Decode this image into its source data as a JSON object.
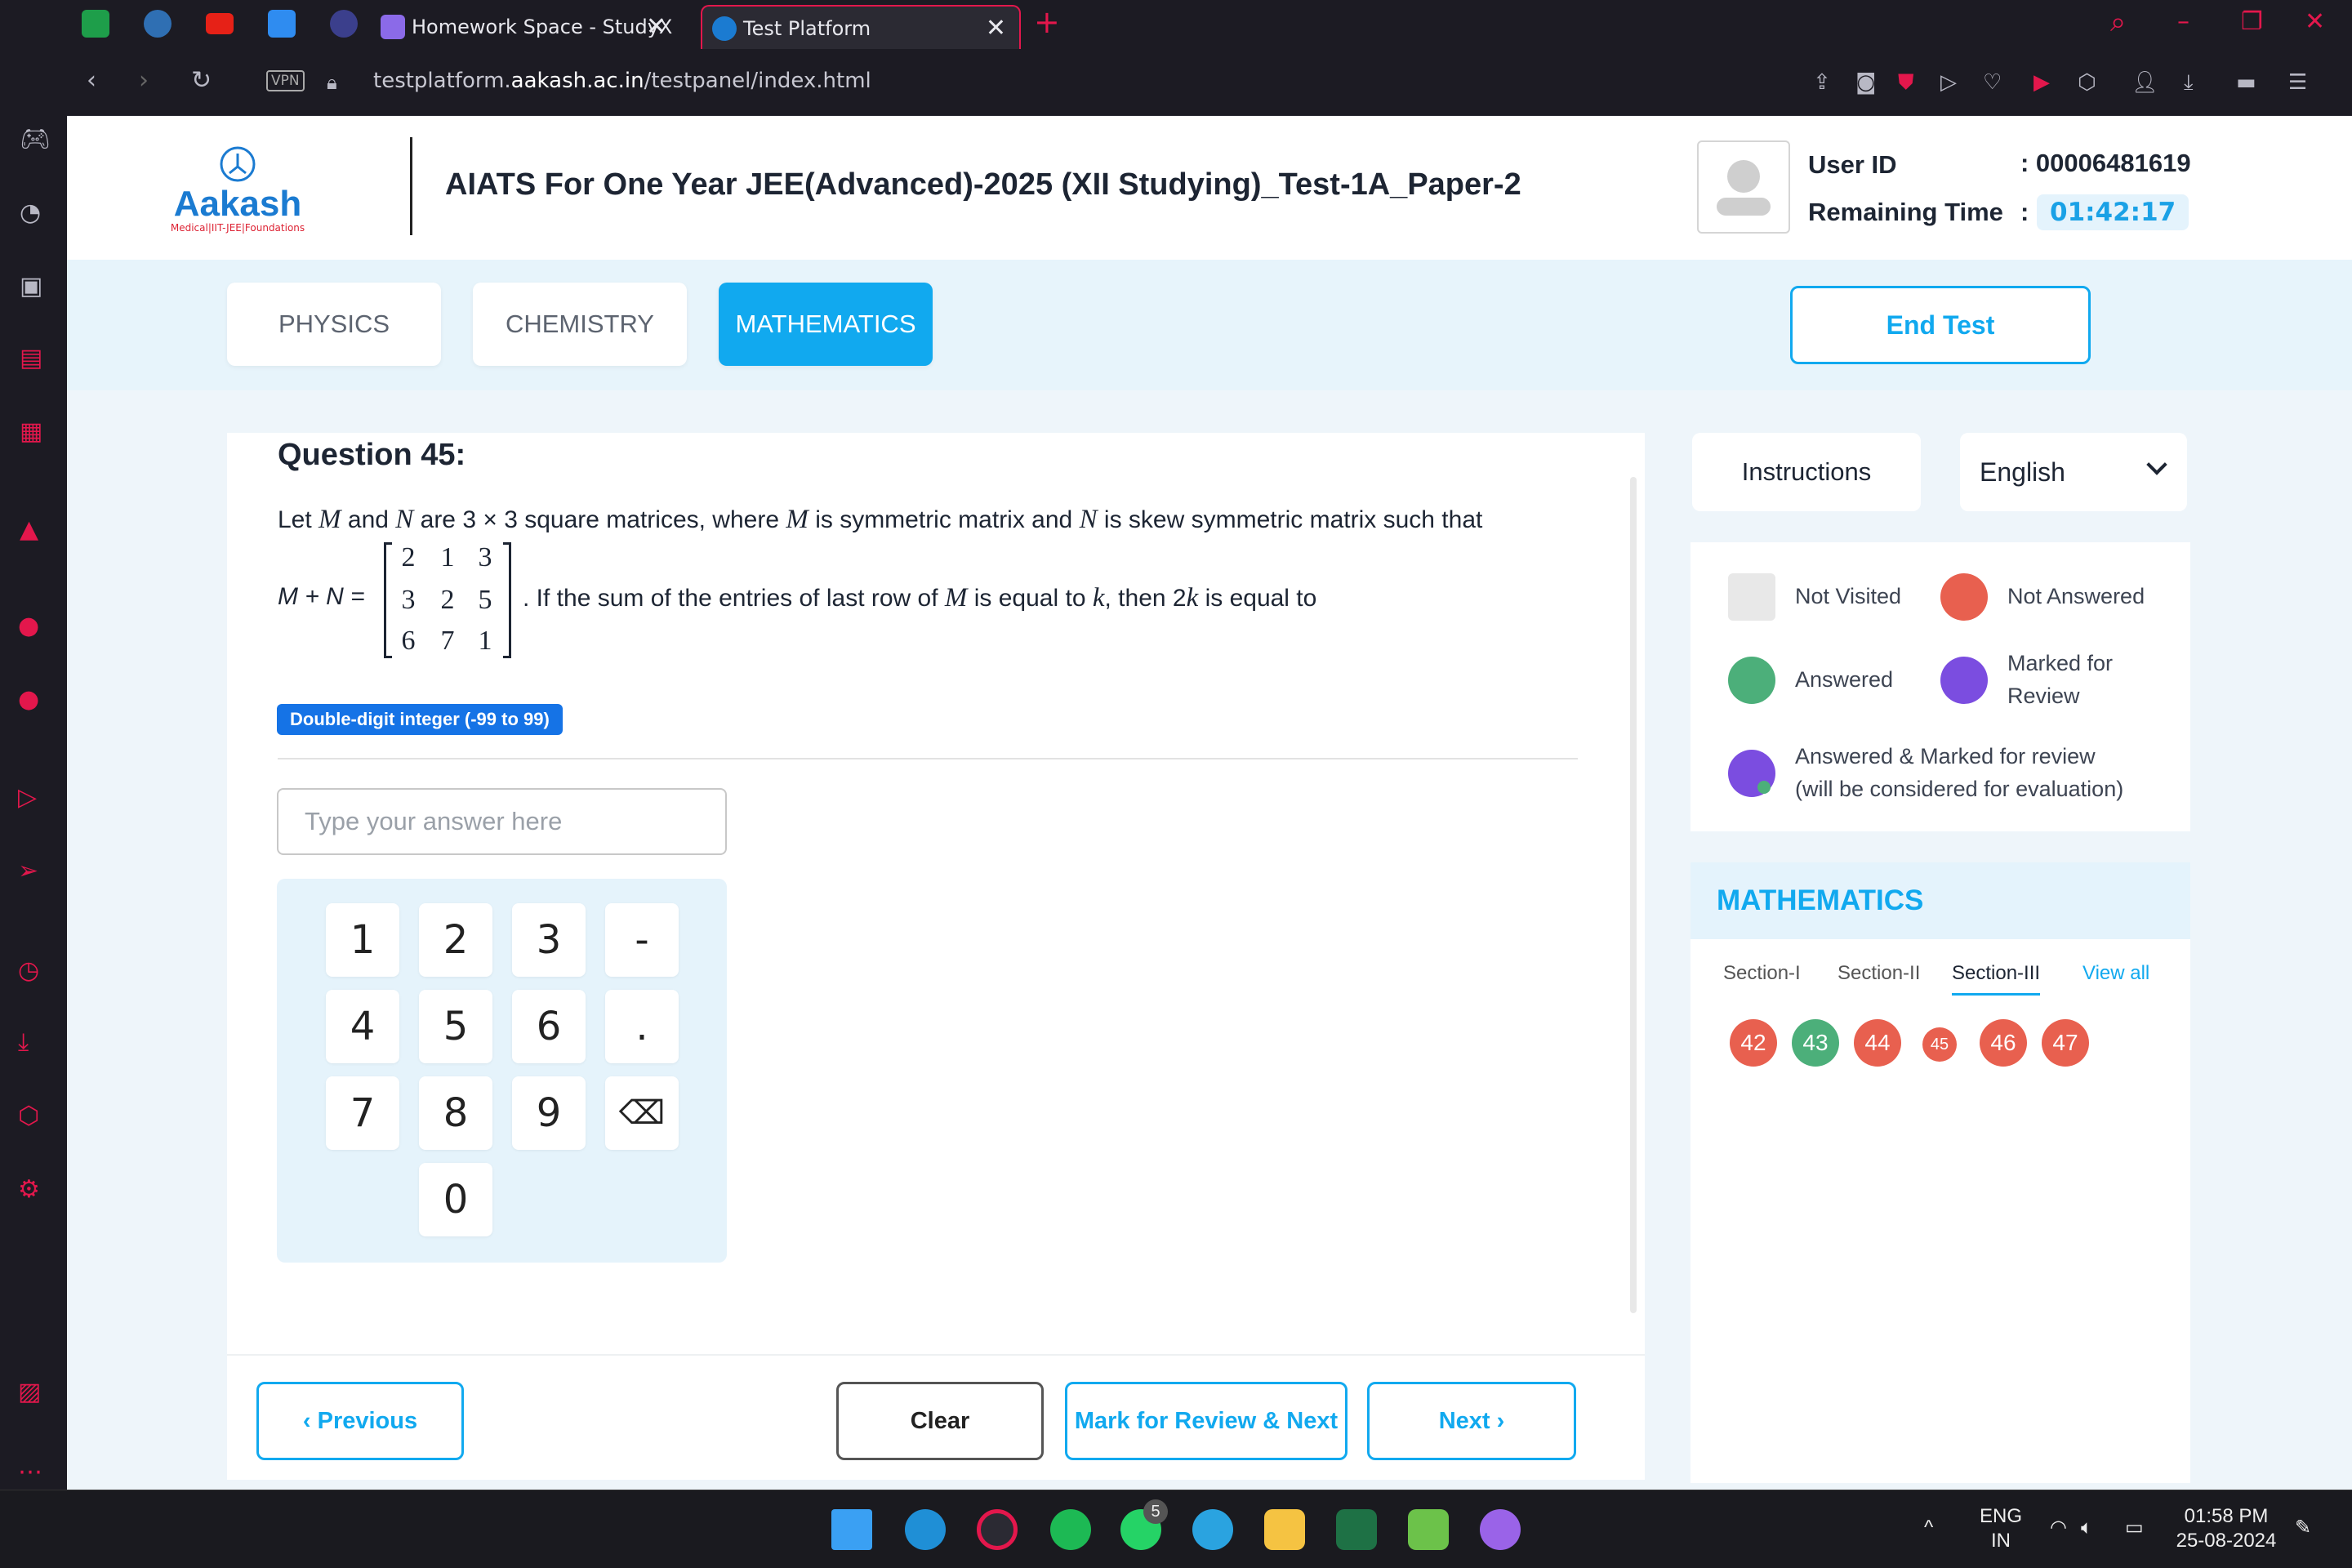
{
  "browser": {
    "tabs": [
      {
        "title": "Homework Space - StudyX",
        "close": "✕"
      },
      {
        "title": "Test Platform",
        "close": "✕"
      }
    ],
    "new_tab": "+",
    "url_prefix": "testplatform.",
    "url_domain": "aakash.ac.in",
    "url_path": "/testpanel/index.html",
    "vpn": "VPN"
  },
  "header": {
    "logo_name": "Aakash",
    "logo_sub": "Medical|IIT-JEE|Foundations",
    "test_title": "AIATS For One Year JEE(Advanced)-2025 (XII Studying)_Test-1A_Paper-2",
    "user_id_label": "User ID",
    "user_id_value": ": 00006481619",
    "remaining_label": "Remaining Time",
    "remaining_colon": ":",
    "remaining_value": "01:42:17"
  },
  "subjects": [
    {
      "label": "PHYSICS",
      "active": false
    },
    {
      "label": "CHEMISTRY",
      "active": false
    },
    {
      "label": "MATHEMATICS",
      "active": true
    }
  ],
  "end_test": "End Test",
  "question": {
    "title": "Question 45:",
    "line1_a": "Let ",
    "var_M": "M",
    "line1_b": " and ",
    "var_N": "N",
    "line1_c": " are 3 × 3 square matrices, where ",
    "line1_d": " is symmetric matrix and ",
    "line1_e": " is skew symmetric matrix such that",
    "lhs": "M + N =",
    "matrix": [
      [
        "2",
        "1",
        "3"
      ],
      [
        "3",
        "2",
        "5"
      ],
      [
        "6",
        "7",
        "1"
      ]
    ],
    "line2_a": ". If the sum of the entries of last row of ",
    "line2_b": " is equal to ",
    "var_k": "k",
    "line2_c": ", then 2",
    "line2_d": " is equal to",
    "type_badge": "Double-digit integer (-99 to 99)",
    "answer_placeholder": "Type your answer here"
  },
  "numpad": [
    "1",
    "2",
    "3",
    "-",
    "4",
    "5",
    "6",
    ".",
    "7",
    "8",
    "9",
    "⌫",
    "0"
  ],
  "footer": {
    "previous": "‹  Previous",
    "clear": "Clear",
    "mark_review": "Mark for Review & Next",
    "next": "Next  ›"
  },
  "sidepanel": {
    "instructions": "Instructions",
    "language": "English",
    "legend": {
      "not_visited": "Not Visited",
      "not_answered": "Not Answered",
      "answered": "Answered",
      "marked_review_1": "Marked for",
      "marked_review_2": "Review",
      "answered_marked_1": "Answered & Marked for review",
      "answered_marked_2": "(will be considered for evaluation)"
    },
    "palette_title": "MATHEMATICS",
    "sections": [
      "Section-I",
      "Section-II",
      "Section-III"
    ],
    "view_all": "View all",
    "questions": [
      "42",
      "43",
      "44",
      "45",
      "46",
      "47"
    ]
  },
  "colors": {
    "accent": "#11a9ef",
    "not_answered": "#e8604f",
    "answered": "#4caf7a",
    "marked": "#7b4de0",
    "not_visited": "#e8e8e8"
  },
  "taskbar": {
    "lang_1": "ENG",
    "lang_2": "IN",
    "time": "01:58 PM",
    "date": "25-08-2024",
    "whatsapp_badge": "5"
  }
}
